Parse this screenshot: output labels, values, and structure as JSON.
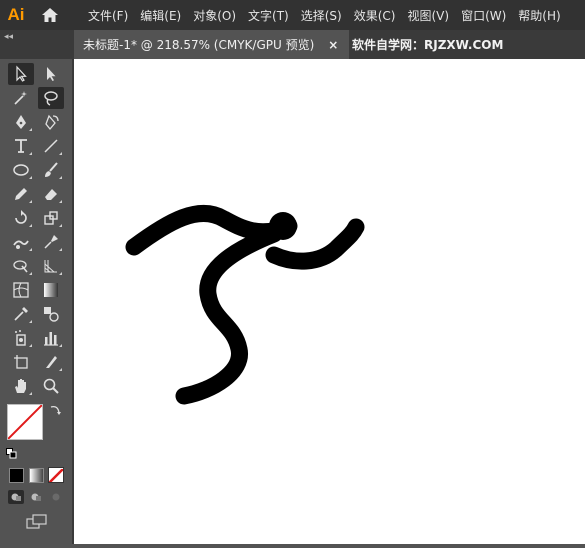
{
  "app": {
    "logo": "Ai",
    "menu": [
      "文件(F)",
      "编辑(E)",
      "对象(O)",
      "文字(T)",
      "选择(S)",
      "效果(C)",
      "视图(V)",
      "窗口(W)",
      "帮助(H)"
    ]
  },
  "tabs": {
    "collapse": "◂◂",
    "active_label": "未标题-1* @ 218.57% (CMYK/GPU 预览)",
    "close": "×",
    "inactive_label": "软件自学网：RJZXW.COM"
  },
  "tools": [
    {
      "name": "selection-tool-icon",
      "selected": true
    },
    {
      "name": "direct-selection-tool-icon"
    },
    {
      "name": "magic-wand-tool-icon"
    },
    {
      "name": "lasso-tool-icon",
      "selected": true
    },
    {
      "name": "pen-tool-icon"
    },
    {
      "name": "curvature-tool-icon"
    },
    {
      "name": "type-tool-icon"
    },
    {
      "name": "line-segment-tool-icon"
    },
    {
      "name": "ellipse-tool-icon"
    },
    {
      "name": "paintbrush-tool-icon"
    },
    {
      "name": "pencil-tool-icon"
    },
    {
      "name": "eraser-tool-icon"
    },
    {
      "name": "rotate-tool-icon"
    },
    {
      "name": "scale-tool-icon"
    },
    {
      "name": "warp-tool-icon"
    },
    {
      "name": "puppet-warp-tool-icon"
    },
    {
      "name": "shape-builder-tool-icon"
    },
    {
      "name": "perspective-grid-tool-icon"
    },
    {
      "name": "mesh-tool-icon"
    },
    {
      "name": "gradient-tool-icon"
    },
    {
      "name": "eyedropper-tool-icon"
    },
    {
      "name": "blend-tool-icon"
    },
    {
      "name": "symbol-sprayer-tool-icon"
    },
    {
      "name": "column-graph-tool-icon"
    },
    {
      "name": "artboard-tool-icon"
    },
    {
      "name": "slice-tool-icon"
    },
    {
      "name": "hand-tool-icon"
    },
    {
      "name": "zoom-tool-icon"
    }
  ],
  "colors": {
    "fill": "#ffffff",
    "stroke": "#000000",
    "accent": "#ff9a00",
    "none_slash": "#e01b1b"
  }
}
